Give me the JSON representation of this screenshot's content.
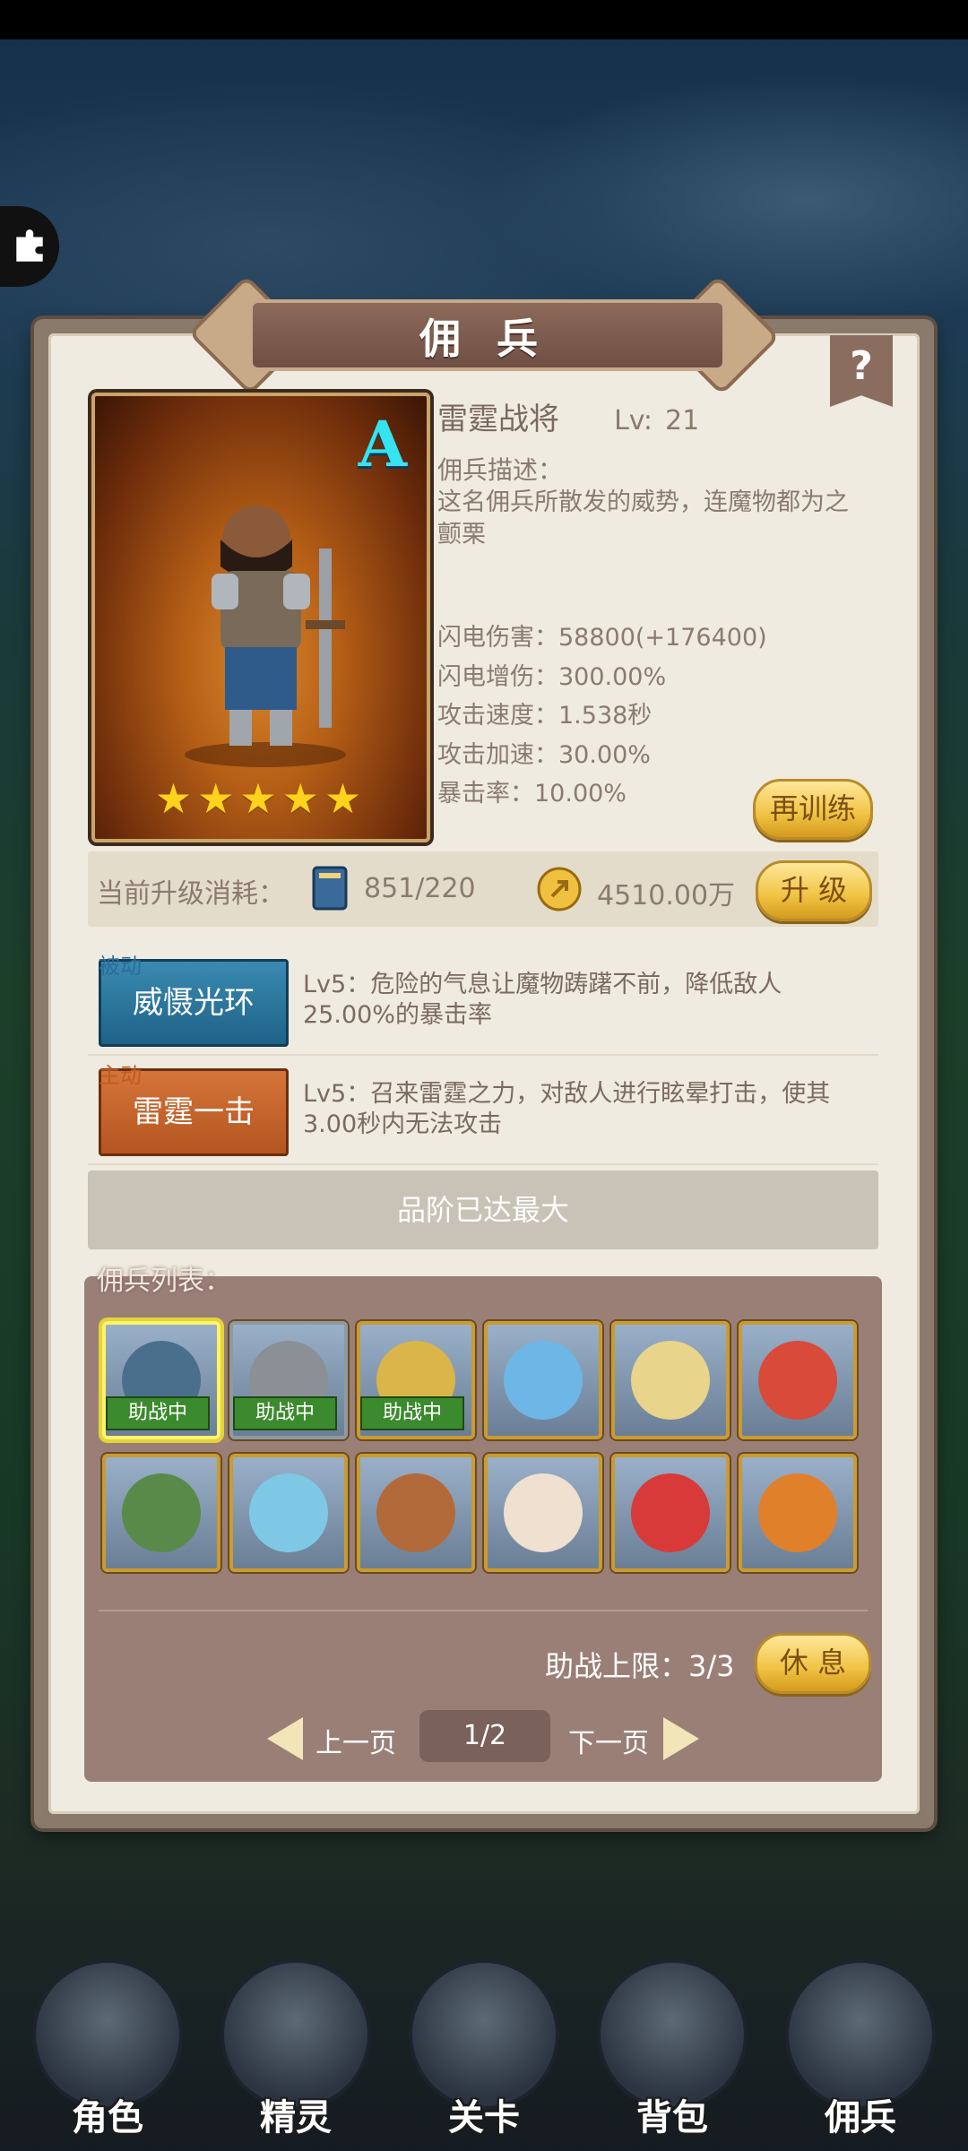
{
  "panel": {
    "title": "佣 兵",
    "help": "?"
  },
  "hero": {
    "grade": "A",
    "stars": "★★★★★",
    "name": "雷霆战将",
    "lv_label": "Lv:",
    "lv_value": "21",
    "desc_label": "佣兵描述：",
    "desc_text": "这名佣兵所散发的威势，连魔物都为之颤栗",
    "stats": [
      "闪电伤害：58800(+176400)",
      "闪电增伤：300.00%",
      "攻击速度：1.538秒",
      "攻击加速：30.00%",
      "暴击率：10.00%"
    ],
    "retrain_label": "再训练"
  },
  "upgrade": {
    "label": "当前升级消耗：",
    "book_count": "851/220",
    "coin_count": "4510.00万",
    "button": "升 级"
  },
  "skills": [
    {
      "type": "被动",
      "name": "威慑光环",
      "desc": "Lv5：危险的气息让魔物踌躇不前，降低敌人25.00%的暴击率"
    },
    {
      "type": "主动",
      "name": "雷霆一击",
      "desc": "Lv5：召来雷霆之力，对敌人进行眩晕打击，使其3.00秒内无法攻击"
    }
  ],
  "max_rank_text": "品阶已达最大",
  "mercenary_list": {
    "title": "佣兵列表：",
    "cells": [
      {
        "status": "助战中",
        "color": "#4a6f8c"
      },
      {
        "status": "助战中",
        "color": "#8a9096"
      },
      {
        "status": "助战中",
        "color": "#d9b54a"
      },
      {
        "status": "",
        "color": "#6db6e6"
      },
      {
        "status": "",
        "color": "#e8d48a"
      },
      {
        "status": "",
        "color": "#d84a3a"
      },
      {
        "status": "",
        "color": "#5a8a4a"
      },
      {
        "status": "",
        "color": "#7ec8e6"
      },
      {
        "status": "",
        "color": "#b36a3a"
      },
      {
        "status": "",
        "color": "#f0e0d0"
      },
      {
        "status": "",
        "color": "#d83a3a"
      },
      {
        "status": "",
        "color": "#e0802a"
      }
    ],
    "limit_text": "助战上限：3/3",
    "rest_button": "休 息",
    "prev_label": "上一页",
    "page": "1/2",
    "next_label": "下一页"
  },
  "nav": [
    "角色",
    "精灵",
    "关卡",
    "背包",
    "佣兵"
  ]
}
